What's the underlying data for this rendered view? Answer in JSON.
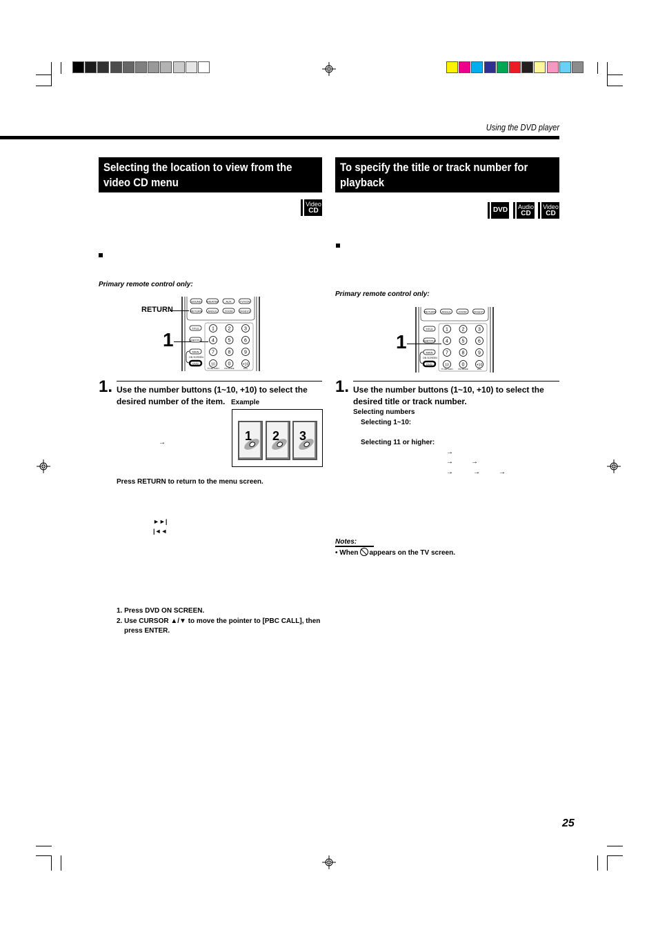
{
  "running_head": "Using the DVD player",
  "page_number": "25",
  "color_bars": {
    "grayscale": [
      "#000000",
      "#1c1c1c",
      "#333333",
      "#4d4d4d",
      "#666666",
      "#808080",
      "#999999",
      "#b3b3b3",
      "#cccccc",
      "#e6e6e6",
      "#ffffff"
    ],
    "colors": [
      "#fff200",
      "#ec008c",
      "#00aeef",
      "#2e3192",
      "#00a651",
      "#ed1c24",
      "#231f20",
      "#fff799",
      "#f49ac1",
      "#6dcff6",
      "#8c8c8c"
    ]
  },
  "left_section": {
    "title_line1": "Selecting the location to view from the",
    "title_line2": "video CD menu",
    "badges": [
      {
        "line1": "Video",
        "line2": "CD"
      }
    ],
    "remote_note": "Primary remote control only:",
    "remote_callouts": {
      "return_label": "RETURN",
      "step_label": "1"
    },
    "step": {
      "number": "1.",
      "text_line1": "Use the number buttons (1~10, +10) to select the",
      "text_line2": "desired number of the item.",
      "example_label": "Example",
      "example_items": [
        "1",
        "2",
        "3"
      ],
      "arrow": "→",
      "return_note": "Press RETURN to return to the menu screen.",
      "next_icon": "►►|",
      "prev_icon": "|◄◄",
      "instructions": [
        "1. Press DVD ON SCREEN.",
        "2. Use CURSOR ▲/▼ to move the pointer to [PBC CALL], then",
        "press ENTER."
      ]
    }
  },
  "right_section": {
    "title_line1": "To specify the title or track number for",
    "title_line2": "playback",
    "badges": [
      {
        "line1": "DVD",
        "line2": ""
      },
      {
        "line1": "Audio",
        "line2": "CD"
      },
      {
        "line1": "Video",
        "line2": "CD"
      }
    ],
    "remote_note": "Primary remote control only:",
    "remote_callouts": {
      "step_label": "1"
    },
    "step": {
      "number": "1.",
      "text_line1": "Use the number buttons (1~10, +10) to select the",
      "text_line2": "desired title or track number.",
      "sub_heading": "Selecting numbers",
      "sel_1_10": "Selecting 1~10:",
      "sel_11": "Selecting 11 or higher:",
      "arrow": "→"
    },
    "notes": {
      "heading": "Notes:",
      "bullet_prefix": "•  When",
      "bullet_suffix": "appears on the TV screen."
    }
  },
  "remote_buttons": {
    "left_top_row1": [
      "SOUND",
      "THEATER",
      "AUX",
      "TV/VCR"
    ],
    "left_top_row2": [
      "RETURN",
      "ANGLE",
      "ZOOM",
      "DIGEST"
    ],
    "right_top_row": [
      "RETURN",
      "ANGLE",
      "ZOOM",
      "DIGEST"
    ],
    "side": [
      "TITLE",
      "SUBTITLE",
      "MAIN",
      "DVD"
    ],
    "numbers": [
      "1",
      "2",
      "3",
      "4",
      "5",
      "6",
      "7",
      "8",
      "9",
      "10",
      "0",
      "+10"
    ],
    "on_screen_label": "ON SCREEN",
    "sub_labels": [
      "TV RETURN",
      "FM MODE",
      "100+"
    ]
  }
}
